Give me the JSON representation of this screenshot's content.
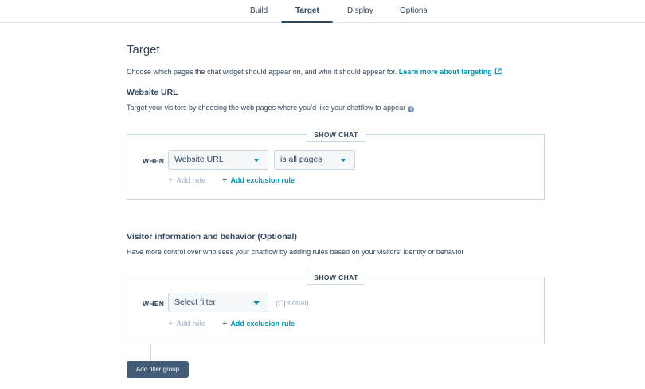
{
  "tabs": [
    {
      "label": "Build",
      "active": false
    },
    {
      "label": "Target",
      "active": true
    },
    {
      "label": "Display",
      "active": false
    },
    {
      "label": "Options",
      "active": false
    }
  ],
  "page": {
    "title": "Target",
    "description": "Choose which pages the chat widget should appear on, and who it should appear for.",
    "learn_more": "Learn more about targeting"
  },
  "website_url": {
    "title": "Website URL",
    "description": "Target your visitors by choosing the web pages where you’d like your chatflow to appear",
    "box_label": "SHOW CHAT",
    "when_label": "WHEN",
    "property_select": "Website URL",
    "operator_select": "is all pages",
    "add_rule": "Add rule",
    "add_exclusion_rule": "Add exclusion rule"
  },
  "visitor": {
    "title": "Visitor information and behavior (Optional)",
    "description": "Have more control over who sees your chatflow by adding rules based on your visitors' identity or behavior",
    "box_label": "SHOW CHAT",
    "when_label": "WHEN",
    "filter_select": "Select filter",
    "optional_label": "(Optional)",
    "add_rule": "Add rule",
    "add_exclusion_rule": "Add exclusion rule",
    "add_filter_group": "Add filter group"
  },
  "colors": {
    "accent": "#0091ae",
    "text": "#33475b",
    "border": "#cbd6e2",
    "button": "#425b76"
  }
}
